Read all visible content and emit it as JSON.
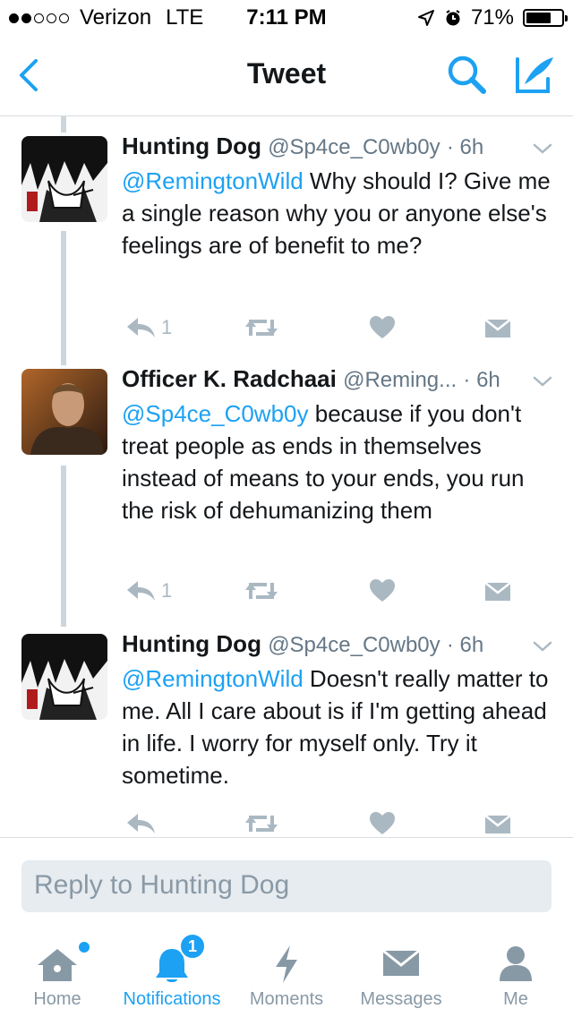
{
  "status_bar": {
    "signal_dots_filled": 2,
    "signal_dots_total": 5,
    "carrier": "Verizon",
    "network": "LTE",
    "time": "7:11 PM",
    "battery": "71%",
    "battery_level": 0.71
  },
  "nav": {
    "title": "Tweet",
    "back_icon": "chevron-left-icon",
    "search_icon": "search-icon",
    "compose_icon": "compose-icon"
  },
  "tweets": [
    {
      "name": "Hunting Dog",
      "handle": "@Sp4ce_C0wb0y",
      "time": "· 6h",
      "mention": "@RemingtonWild",
      "text": " Why should I? Give me a single reason why you or anyone else's feelings are of benefit to me?",
      "reply_count": "1"
    },
    {
      "name": "Officer K. Radchaai",
      "handle": "@Reming...",
      "time": "· 6h",
      "mention": "@Sp4ce_C0wb0y",
      "text": " because if you don't treat people as ends in themselves instead of means to your ends, you run the risk of dehumanizing them",
      "reply_count": "1"
    },
    {
      "name": "Hunting Dog",
      "handle": "@Sp4ce_C0wb0y",
      "time": "· 6h",
      "mention": "@RemingtonWild",
      "text": " Doesn't really matter to me. All I care about is if I'm getting ahead in life. I worry for myself only. Try it sometime.",
      "reply_count": ""
    }
  ],
  "reply": {
    "placeholder": "Reply to Hunting Dog"
  },
  "tabbar": {
    "items": [
      {
        "label": "Home",
        "icon": "home-icon"
      },
      {
        "label": "Notifications",
        "icon": "bell-icon",
        "badge": "1"
      },
      {
        "label": "Moments",
        "icon": "lightning-icon"
      },
      {
        "label": "Messages",
        "icon": "envelope-icon"
      },
      {
        "label": "Me",
        "icon": "person-icon"
      }
    ]
  },
  "colors": {
    "accent": "#1da1f2",
    "text": "#14171a",
    "muted": "#657786",
    "icon_gray": "#aab8c2",
    "divider": "#d8dde1"
  }
}
